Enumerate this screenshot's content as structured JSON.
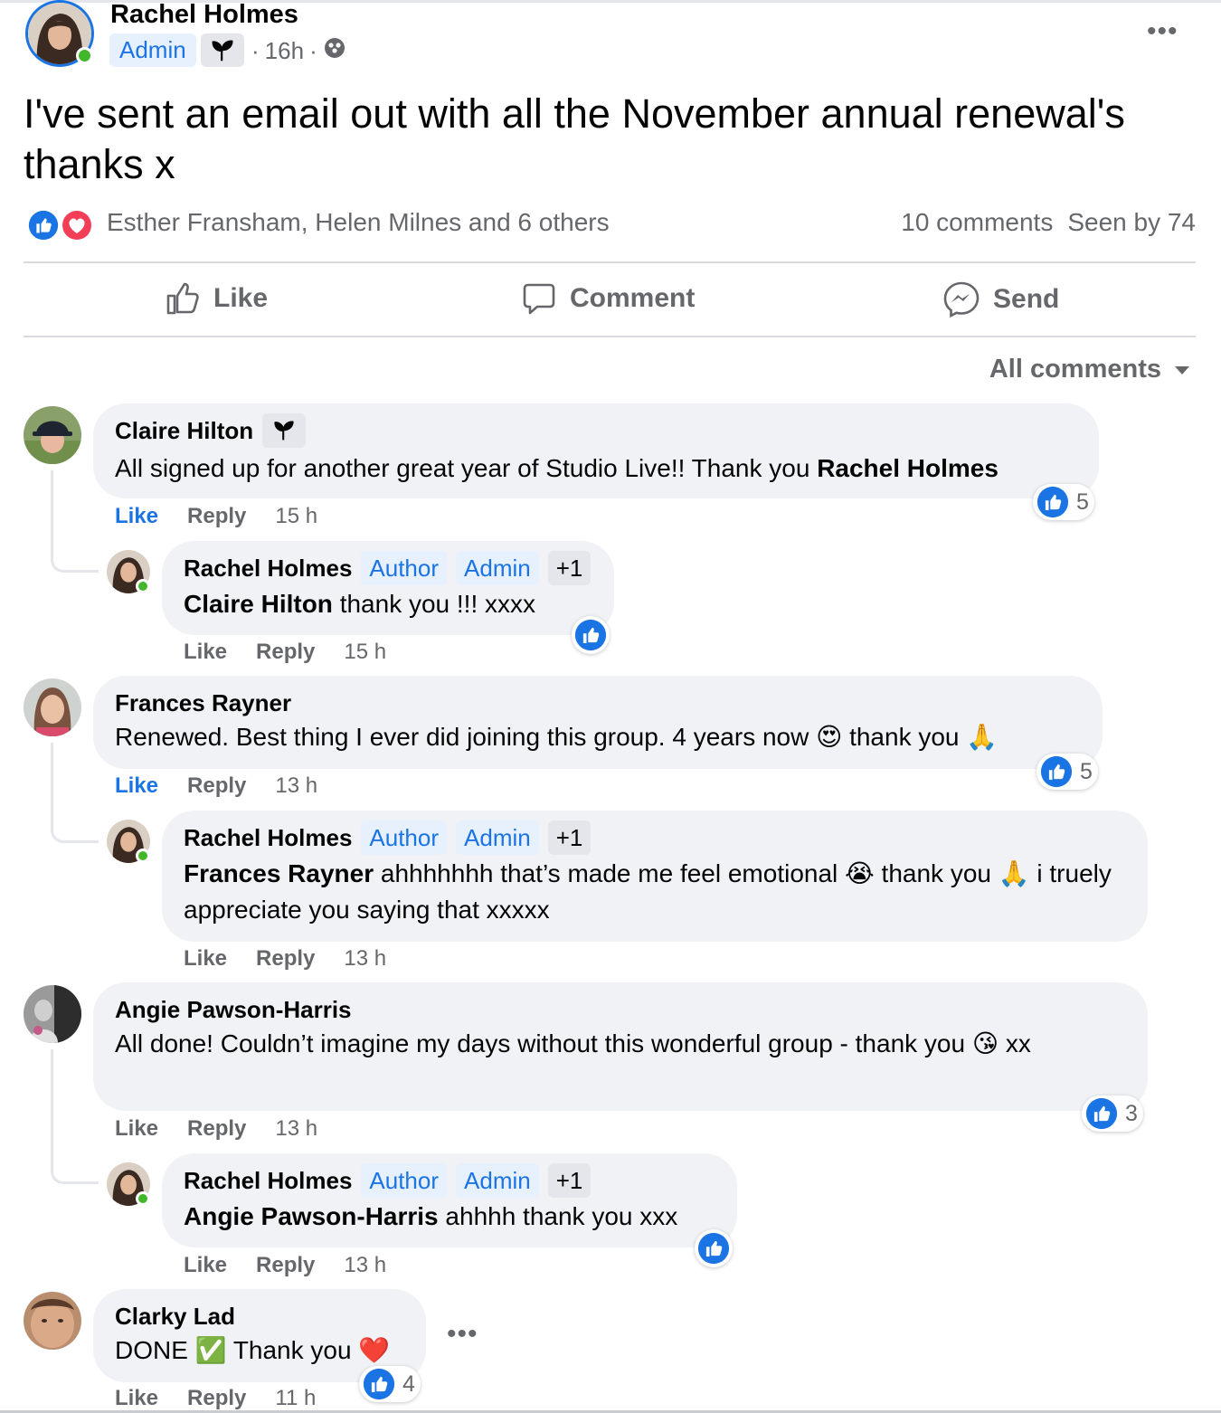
{
  "post": {
    "author": "Rachel Holmes",
    "badge": "Admin",
    "time": "16h",
    "separator": "·",
    "more": "•••",
    "text": "I've sent an email out with all the November annual renewal's thanks x",
    "reactors": "Esther Fransham, Helen Milnes and 6 others",
    "comments_count": "10 comments",
    "seen_by": "Seen by 74"
  },
  "actions": {
    "like": "Like",
    "comment": "Comment",
    "send": "Send"
  },
  "sort_label": "All comments",
  "colors": {
    "blue": "#1b74e4",
    "gray_text": "#65676b",
    "bubble": "#f0f2f5",
    "heart": "#f33e58"
  },
  "comments": [
    {
      "name": "Claire Hilton",
      "text": "All signed up for another great year of Studio Live!! Thank you ",
      "mention": "Rachel Holmes",
      "like": "Like",
      "reply": "Reply",
      "time": "15 h",
      "reactions": "5",
      "reply_item": {
        "name": "Rachel Holmes",
        "tag1": "Author",
        "tag2": "Admin",
        "tag3": "+1",
        "mention": "Claire Hilton",
        "text": " thank you !!! xxxx",
        "like": "Like",
        "reply": "Reply",
        "time": "15 h"
      }
    },
    {
      "name": "Frances Rayner",
      "text": "Renewed. Best thing I ever did joining this group. 4 years now 😍 thank you 🙏",
      "like": "Like",
      "reply": "Reply",
      "time": "13 h",
      "reactions": "5",
      "reply_item": {
        "name": "Rachel Holmes",
        "tag1": "Author",
        "tag2": "Admin",
        "tag3": "+1",
        "mention": "Frances Rayner",
        "text": " ahhhhhhh that’s made me feel emotional 😭 thank you 🙏 i truely appreciate you saying that xxxxx",
        "like": "Like",
        "reply": "Reply",
        "time": "13 h"
      }
    },
    {
      "name": "Angie Pawson-Harris",
      "text": "All done! Couldn’t imagine my days without this wonderful group - thank you 😘 xx",
      "like": "Like",
      "reply": "Reply",
      "time": "13 h",
      "reactions": "3",
      "reply_item": {
        "name": "Rachel Holmes",
        "tag1": "Author",
        "tag2": "Admin",
        "tag3": "+1",
        "mention": "Angie Pawson-Harris",
        "text": " ahhhh thank you xxx",
        "like": "Like",
        "reply": "Reply",
        "time": "13 h"
      }
    },
    {
      "name": "Clarky Lad",
      "text": "DONE ✅ Thank you ❤️",
      "like": "Like",
      "reply": "Reply",
      "time": "11 h",
      "reactions": "4",
      "more": "•••"
    }
  ]
}
